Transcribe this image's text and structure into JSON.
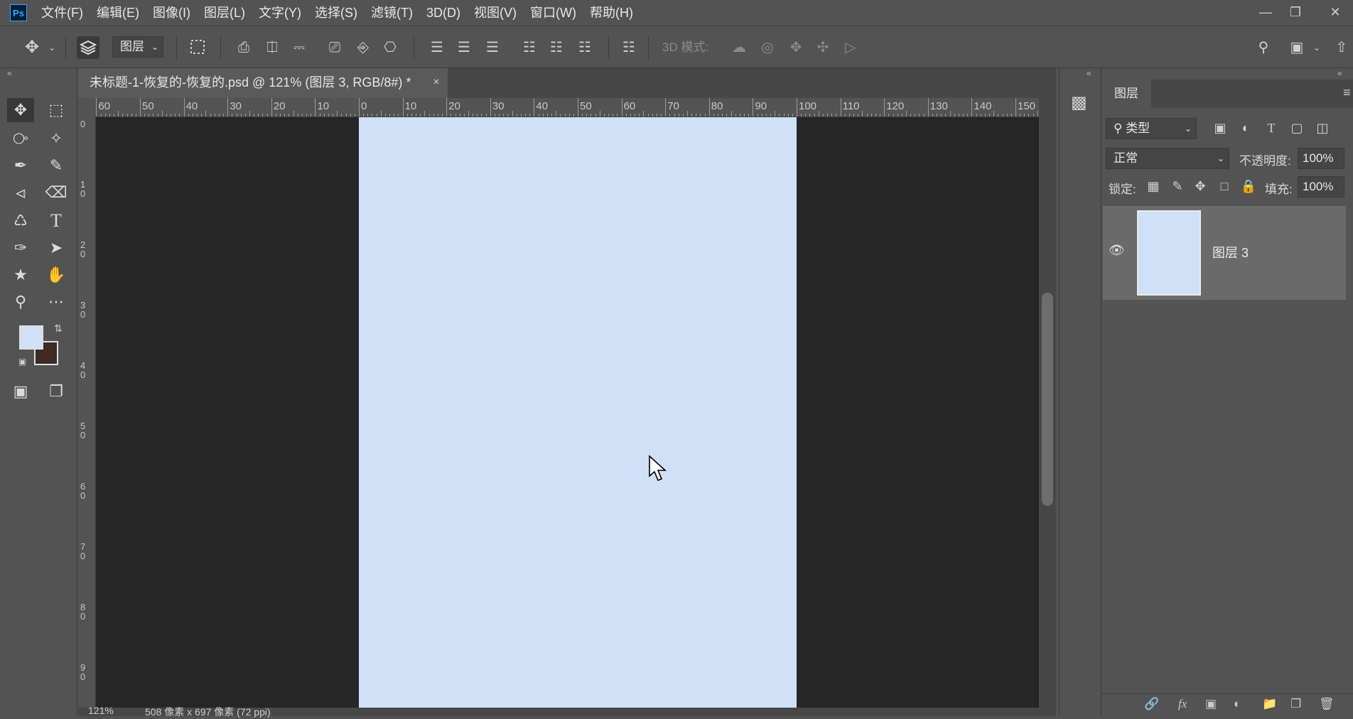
{
  "app": {
    "logo": "Ps"
  },
  "menu": [
    "文件(F)",
    "编辑(E)",
    "图像(I)",
    "图层(L)",
    "文字(Y)",
    "选择(S)",
    "滤镜(T)",
    "3D(D)",
    "视图(V)",
    "窗口(W)",
    "帮助(H)"
  ],
  "options_bar": {
    "auto_select_target": "图层",
    "mode_3d_label": "3D 模式:"
  },
  "document": {
    "tab_title": "未标题-1-恢复的-恢复的.psd @ 121% (图层 3, RGB/8#) *",
    "close_glyph": "×",
    "canvas_color": "#cfe0f7"
  },
  "ruler_top": [
    "60",
    "50",
    "40",
    "30",
    "20",
    "10",
    "0",
    "10",
    "20",
    "30",
    "40",
    "50",
    "60",
    "70",
    "80",
    "90",
    "100",
    "110",
    "120",
    "130",
    "140",
    "150"
  ],
  "ruler_left": [
    "0",
    "1 0",
    "2 0",
    "3 0",
    "4 0",
    "5 0",
    "6 0",
    "7 0",
    "8 0",
    "9 0"
  ],
  "status": {
    "zoom": "121%",
    "doc_size": "508 像素 x 697 像素 (72 ppi)"
  },
  "colors": {
    "foreground": "#cfe0f7",
    "background": "#3e2a22",
    "accent": "#31a8ff"
  },
  "layers_panel": {
    "tab": "图层",
    "filter_kind": "类型",
    "blend_mode": "正常",
    "opacity_label": "不透明度:",
    "opacity_value": "100%",
    "lock_label": "锁定:",
    "fill_label": "填充:",
    "fill_value": "100%",
    "layers": [
      {
        "name": "图层 3",
        "visible": true,
        "thumb_color": "#cfe0f7"
      }
    ]
  },
  "icons": {
    "move": "move-icon",
    "marquee": "rect-marquee-icon",
    "lasso": "lasso-icon",
    "magic_wand": "magic-wand-icon",
    "eyedropper": "eyedropper-icon",
    "brush": "brush-icon",
    "stamp": "stamp-icon",
    "eraser": "eraser-icon",
    "bucket": "paint-bucket-icon",
    "type": "type-icon",
    "pen": "pen-icon",
    "path_select": "path-select-icon",
    "shape": "shape-icon",
    "hand": "hand-icon",
    "zoom": "zoom-icon",
    "more": "more-icon"
  }
}
